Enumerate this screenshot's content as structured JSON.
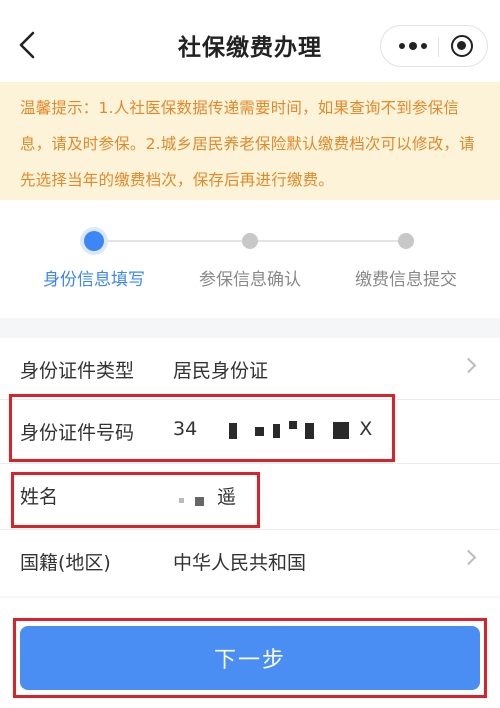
{
  "nav": {
    "title": "社保缴费办理"
  },
  "notice": {
    "text": "温馨提示：1.人社医保数据传递需要时间，如果查询不到参保信息，请及时参保。2.城乡居民养老保险默认缴费档次可以修改，请先选择当年的缴费档次，保存后再进行缴费。"
  },
  "steps": [
    {
      "label": "身份信息填写",
      "active": true
    },
    {
      "label": "参保信息确认",
      "active": false
    },
    {
      "label": "缴费信息提交",
      "active": false
    }
  ],
  "form": {
    "id_type": {
      "label": "身份证件类型",
      "value": "居民身份证"
    },
    "id_number": {
      "label": "身份证件号码",
      "value_visible_start": "34",
      "value_visible_end": "X"
    },
    "name": {
      "label": "姓名",
      "value_visible": "遥"
    },
    "nationality": {
      "label": "国籍(地区)",
      "value": "中华人民共和国"
    }
  },
  "next_button": {
    "label": "下一步"
  },
  "colors": {
    "accent": "#3d86f5",
    "button": "#4a8ef4",
    "notice_bg": "#fdf3d8",
    "notice_text": "#e2892a",
    "highlight": "#d8232a"
  }
}
